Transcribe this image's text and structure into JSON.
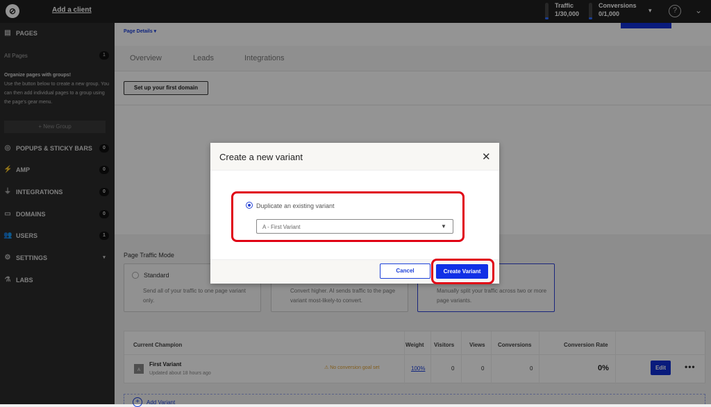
{
  "topbar": {
    "add_client": "Add a client",
    "traffic_label": "Traffic",
    "traffic_value": "1/30,000",
    "conversions_label": "Conversions",
    "conversions_value": "0/1,000",
    "help": "?",
    "dropdown_caret": "▾",
    "user_caret": "⌄"
  },
  "sidebar": {
    "pages_label": "PAGES",
    "all_pages": "All Pages",
    "all_pages_count": "1",
    "help_title": "Organize pages with groups!",
    "help_text": "Use the button below to create a new group. You can then add individual pages to a group using the page's gear menu.",
    "new_group": "+ New Group",
    "items": [
      {
        "label": "POPUPS & STICKY BARS",
        "count": "0"
      },
      {
        "label": "AMP",
        "count": "0"
      },
      {
        "label": "INTEGRATIONS",
        "count": "0"
      },
      {
        "label": "DOMAINS",
        "count": "0"
      },
      {
        "label": "USERS",
        "count": "1"
      },
      {
        "label": "SETTINGS",
        "count": "▾"
      },
      {
        "label": "LABS",
        "count": ""
      }
    ]
  },
  "main": {
    "page_details": "Page Details ▾",
    "tabs": [
      {
        "label": "Overview"
      },
      {
        "label": "Leads"
      },
      {
        "label": "Integrations"
      }
    ],
    "setup_domain": "Set up your first domain",
    "traffic_mode_title": "Page Traffic Mode",
    "modes": [
      {
        "title": "Standard",
        "desc": "Send all of your traffic to one page variant only."
      },
      {
        "title": "",
        "desc": "Convert higher. AI sends traffic to the page variant most-likely-to convert."
      },
      {
        "title": "",
        "desc": "Manually split your traffic across two or more page variants."
      }
    ],
    "table": {
      "headers": [
        "Current Champion",
        "Weight",
        "Visitors",
        "Views",
        "Conversions",
        "Conversion Rate"
      ],
      "row": {
        "avatar": "A",
        "name": "First Variant",
        "updated": "Updated about 18 hours ago",
        "warning": "⚠ No conversion goal set",
        "weight": "100%",
        "visitors": "0",
        "views": "0",
        "conversions": "0",
        "rate": "0%",
        "edit": "Edit",
        "more": "•••"
      }
    },
    "add_variant": "Add Variant"
  },
  "modal": {
    "title": "Create a new variant",
    "close": "✕",
    "option_label": "Duplicate an existing variant",
    "select_value": "A - First Variant",
    "select_caret": "▼",
    "cancel": "Cancel",
    "create": "Create Variant"
  }
}
